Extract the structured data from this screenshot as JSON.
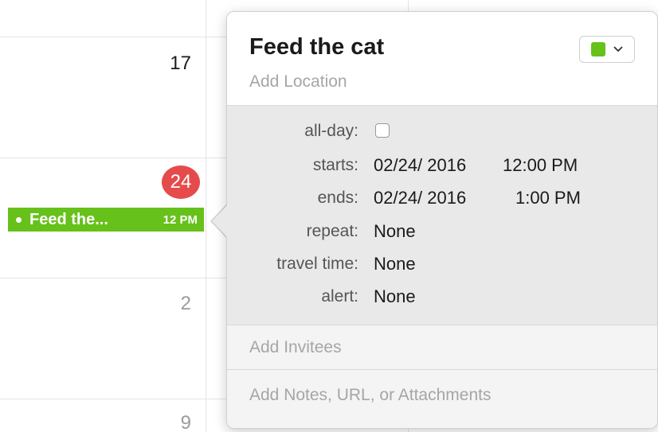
{
  "calendar": {
    "days": {
      "seventeen": "17",
      "today": "24",
      "two": "2",
      "nine": "9"
    },
    "event_chip": {
      "title": "Feed the...",
      "time": "12 PM",
      "color": "#66c11a"
    },
    "today_badge_color": "#e64b4b"
  },
  "event": {
    "title": "Feed the cat",
    "location_placeholder": "Add Location",
    "calendar_color": "#66c11a",
    "color_picker_icon": "chevron-down-icon",
    "fields": {
      "all_day": {
        "label": "all-day:",
        "checked": false
      },
      "starts": {
        "label": "starts:",
        "date": "02/24/ 2016",
        "time": "12:00 PM"
      },
      "ends": {
        "label": "ends:",
        "date": "02/24/ 2016",
        "time": "1:00 PM"
      },
      "repeat": {
        "label": "repeat:",
        "value": "None"
      },
      "travel_time": {
        "label": "travel time:",
        "value": "None"
      },
      "alert": {
        "label": "alert:",
        "value": "None"
      }
    },
    "invitees_placeholder": "Add Invitees",
    "notes_placeholder": "Add Notes, URL, or Attachments"
  }
}
